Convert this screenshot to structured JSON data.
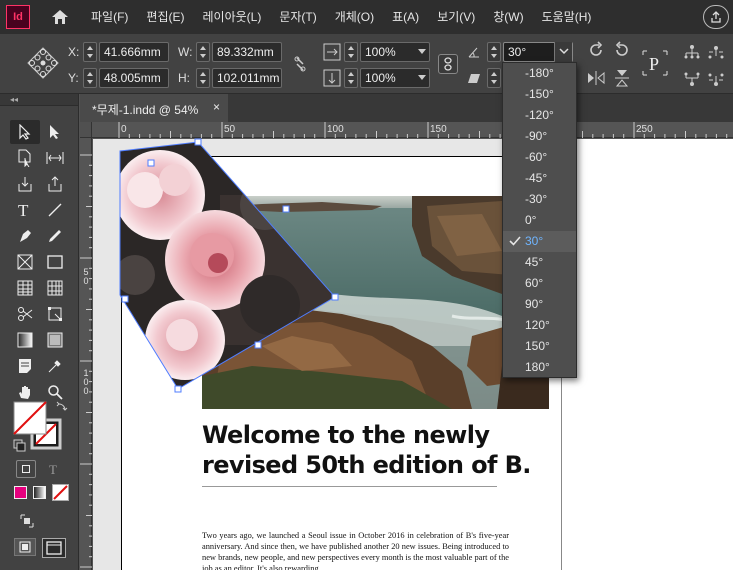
{
  "app": {
    "icon_label": "Id"
  },
  "menu": {
    "items": [
      "파일(F)",
      "편집(E)",
      "레이아웃(L)",
      "문자(T)",
      "개체(O)",
      "표(A)",
      "보기(V)",
      "창(W)",
      "도움말(H)"
    ]
  },
  "control": {
    "x_label": "X:",
    "x_value": "41.666mm",
    "y_label": "Y:",
    "y_value": "48.005mm",
    "w_label": "W:",
    "w_value": "89.332mm",
    "h_label": "H:",
    "h_value": "102.011mm",
    "scale_x": "100%",
    "scale_y": "100%",
    "rotation": "30°"
  },
  "document": {
    "tab_title": "*무제-1.indd @ 54%",
    "tab_close": "×",
    "ruler_top": [
      "0",
      "50",
      "100",
      "150",
      "200",
      "250"
    ],
    "ruler_left": [
      [
        "5",
        "0"
      ],
      [
        "1",
        "0",
        "0"
      ]
    ]
  },
  "page_content": {
    "headline": "Welcome to the newly revised 50th edition of B.",
    "body": "Two years ago, we launched a Seoul issue in October 2016 in celebration of B's five-year anniversary. And since then, we have published another 20 new issues. Being introduced to new brands, new people, and new perspectives every month is the most valuable part of the job as an editor. It's also rewarding"
  },
  "rotation_dropdown": {
    "options": [
      "-180°",
      "-150°",
      "-120°",
      "-90°",
      "-60°",
      "-45°",
      "-30°",
      "0°",
      "30°",
      "45°",
      "60°",
      "90°",
      "120°",
      "150°",
      "180°"
    ],
    "selected": "30°"
  },
  "colors": {
    "accent": "#ff3366",
    "selected_text": "#6fb5ff",
    "frame_blue": "#4f7dff"
  }
}
